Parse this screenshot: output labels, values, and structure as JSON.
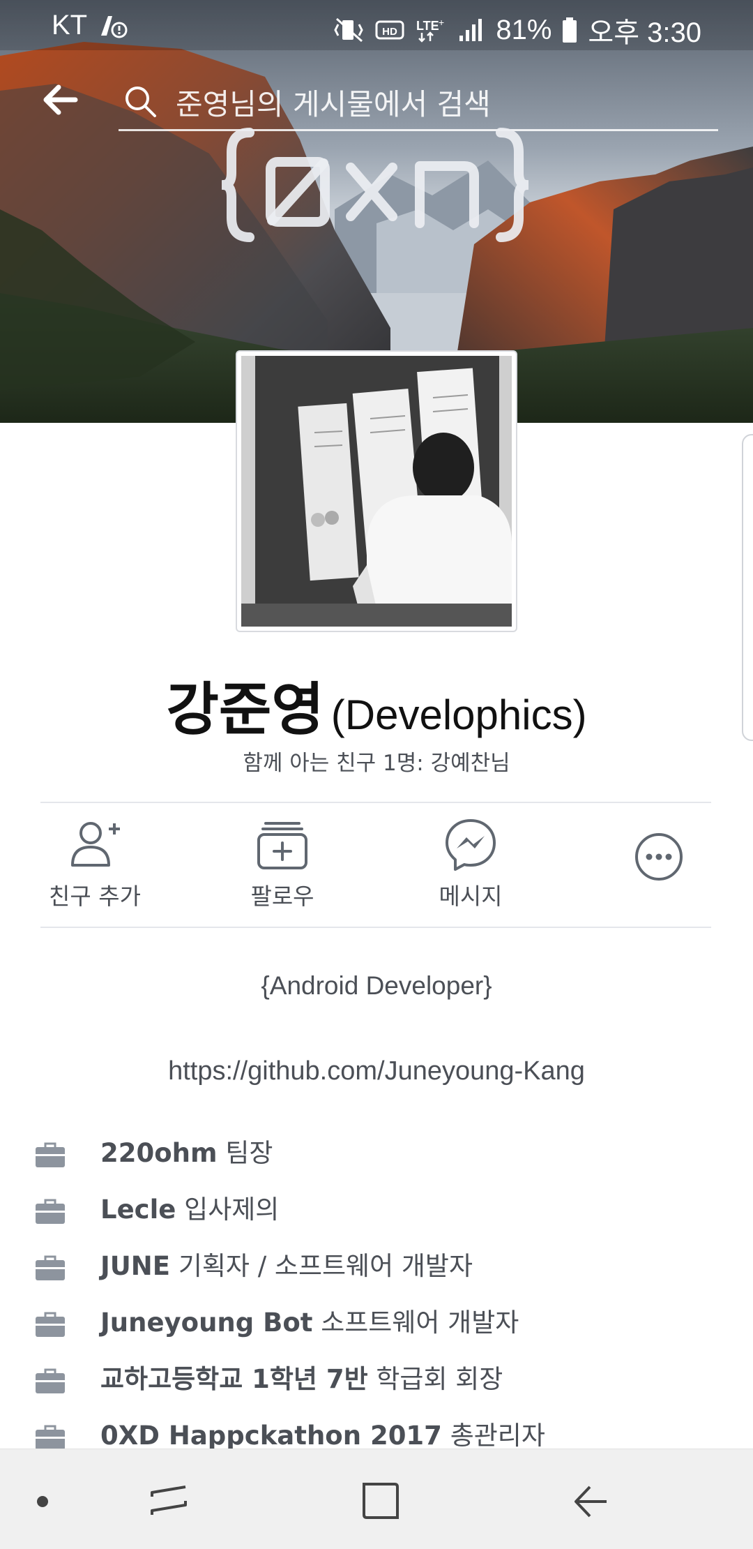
{
  "status_bar": {
    "carrier": "KT",
    "battery": "81%",
    "time": "오후 3:30",
    "icons": [
      "vibrate-icon",
      "hd-icon",
      "lte-icon",
      "signal-icon",
      "battery-icon"
    ]
  },
  "search": {
    "placeholder": "준영님의 게시물에서 검색"
  },
  "profile": {
    "name": "강준영",
    "alt_name": "(Develophics)",
    "mutual_friends": "함께 아는 친구 1명: 강예찬님",
    "bio": "{Android Developer}",
    "link": "https://github.com/Juneyoung-Kang"
  },
  "actions": [
    {
      "label": "친구 추가",
      "icon": "add-friend-icon"
    },
    {
      "label": "팔로우",
      "icon": "follow-icon"
    },
    {
      "label": "메시지",
      "icon": "messenger-icon"
    },
    {
      "label": "",
      "icon": "more-icon"
    }
  ],
  "work": [
    {
      "bold": "220ohm",
      "rest": " 팀장"
    },
    {
      "bold": "Lecle",
      "rest": " 입사제의"
    },
    {
      "bold": "JUNE",
      "rest": " 기획자 / 소프트웨어 개발자"
    },
    {
      "bold": "Juneyoung Bot",
      "rest": " 소프트웨어 개발자"
    },
    {
      "bold": "교하고등학교 1학년 7반",
      "rest": " 학급회 회장"
    },
    {
      "bold": "0XD Happckathon 2017",
      "rest": " 총관리자"
    }
  ],
  "colors": {
    "text_secondary": "#4b4f56",
    "divider": "#e4e6eb",
    "navbar": "#f0f0f0"
  }
}
